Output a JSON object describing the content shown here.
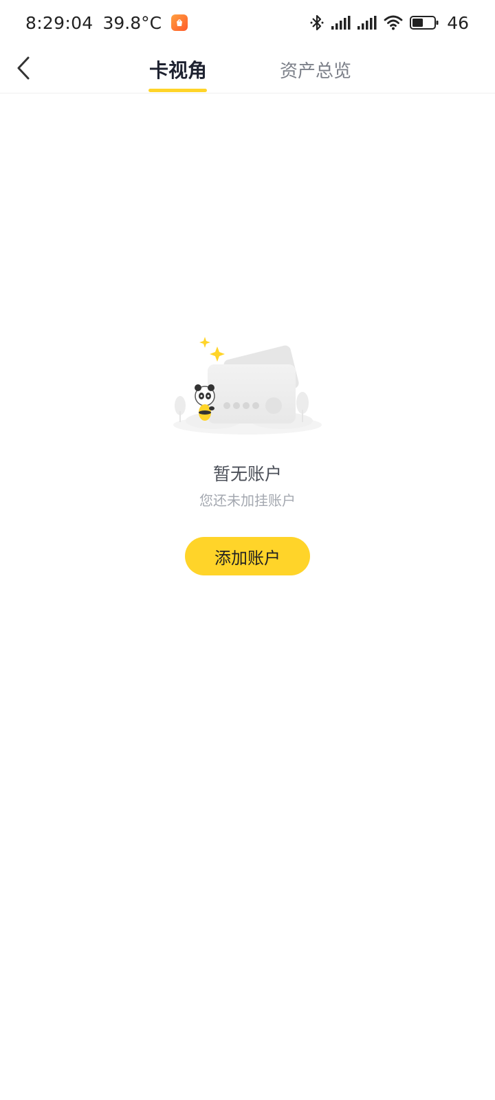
{
  "status_bar": {
    "time": "8:29:04",
    "temperature": "39.8°C",
    "battery_level": "46",
    "icons": [
      "app-notification-icon",
      "bluetooth-icon",
      "signal-icon",
      "signal-icon",
      "wifi-icon",
      "battery-icon"
    ]
  },
  "header": {
    "back_icon": "chevron-left-icon",
    "tabs": [
      {
        "label": "卡视角",
        "active": true
      },
      {
        "label": "资产总览",
        "active": false
      }
    ],
    "accent_color": "#ffd429"
  },
  "empty_state": {
    "illustration": "panda-card-illustration",
    "title": "暂无账户",
    "subtitle": "您还未加挂账户",
    "button_label": "添加账户",
    "button_color": "#ffd429"
  }
}
